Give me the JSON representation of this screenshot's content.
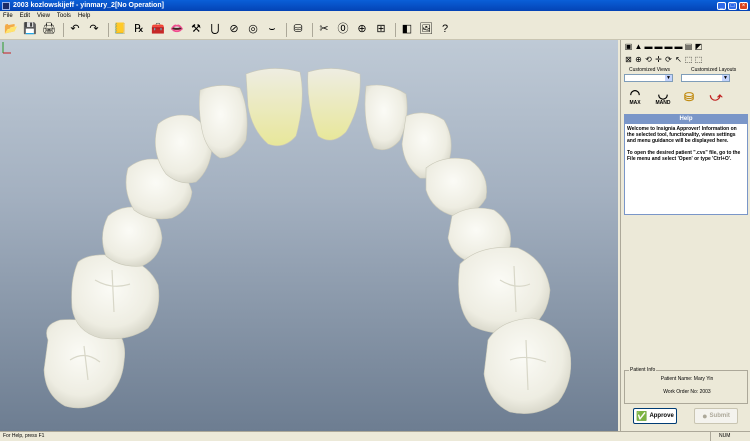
{
  "window": {
    "title": "2003 kozlowskijeff - yinmary_2[No Operation]"
  },
  "menu": [
    "File",
    "Edit",
    "View",
    "Tools",
    "Help"
  ],
  "toolbar_icons": [
    {
      "name": "open-icon",
      "glyph": "📂"
    },
    {
      "name": "save-icon",
      "glyph": "💾"
    },
    {
      "name": "print-icon",
      "glyph": "🖨"
    },
    {
      "name": "sep"
    },
    {
      "name": "undo-icon",
      "glyph": "↶"
    },
    {
      "name": "redo-icon",
      "glyph": "↷"
    },
    {
      "name": "sep"
    },
    {
      "name": "notes-icon",
      "glyph": "📒"
    },
    {
      "name": "prescription-icon",
      "glyph": "℞"
    },
    {
      "name": "toolbox-icon",
      "glyph": "🧰"
    },
    {
      "name": "lips-icon",
      "glyph": "👄"
    },
    {
      "name": "hammer-icon",
      "glyph": "⚒"
    },
    {
      "name": "arch-form-icon",
      "glyph": "⋃"
    },
    {
      "name": "measure-icon",
      "glyph": "⊘"
    },
    {
      "name": "occlusion-icon",
      "glyph": "◎"
    },
    {
      "name": "smile-icon",
      "glyph": "⌣"
    },
    {
      "name": "sep"
    },
    {
      "name": "gold-tooth-icon",
      "glyph": "⛁"
    },
    {
      "name": "sep"
    },
    {
      "name": "tooth-scissors-icon",
      "glyph": "✂"
    },
    {
      "name": "torque-icon",
      "glyph": "⓪"
    },
    {
      "name": "interproximal-icon",
      "glyph": "⊕"
    },
    {
      "name": "ipr-icon",
      "glyph": "⊞"
    },
    {
      "name": "sep"
    },
    {
      "name": "split-view-icon",
      "glyph": "◧"
    },
    {
      "name": "screenshot-icon",
      "glyph": "🖼"
    },
    {
      "name": "help-icon",
      "glyph": "?"
    }
  ],
  "panel": {
    "view_icons_row1": [
      "▣",
      "▲",
      "▬",
      "▬",
      "▬",
      "▬",
      "▤",
      "◩"
    ],
    "view_icons_row2": [
      "⊠",
      "⊕",
      "⟲",
      "✛",
      "⟳",
      "↖",
      "⬚",
      "⬚"
    ],
    "customized_views_label": "Customized Views",
    "customized_layouts_label": "Customized Layouts",
    "max_label": "MAX",
    "mand_label": "MAND",
    "help_header": "Help",
    "help_para1": "Welcome to Insignia Approver! Information on the selected tool, functionality, views settings and menu guidance will be displayed here.",
    "help_para2": "To open the desired patient \".cvs\" file, go to the File menu and select 'Open' or type 'Ctrl+O'.",
    "patient_info_legend": "Patient Info",
    "patient_name": "Patient Name: Mary Yin",
    "work_order": "Work Order No: 2003",
    "approve_label": "Approve",
    "submit_label": "Submit"
  },
  "status": {
    "left": "For Help, press F1",
    "right": "NUM"
  }
}
